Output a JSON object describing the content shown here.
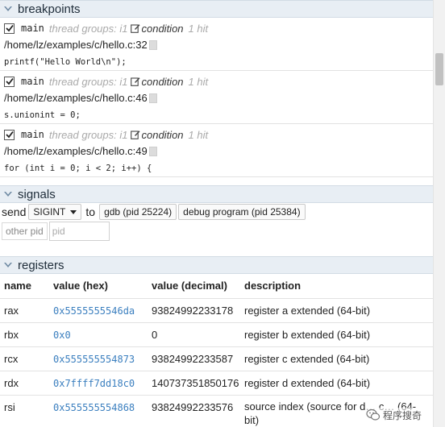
{
  "sections": {
    "breakpoints": "breakpoints",
    "signals": "signals",
    "registers": "registers"
  },
  "breakpoints": [
    {
      "checked": true,
      "function": "main",
      "thread_groups": "thread groups: i1",
      "condition": "condition",
      "hits": "1 hit",
      "location": "/home/lz/examples/c/hello.c:32",
      "code": "printf(\"Hello World\\n\");"
    },
    {
      "checked": true,
      "function": "main",
      "thread_groups": "thread groups: i1",
      "condition": "condition",
      "hits": "1 hit",
      "location": "/home/lz/examples/c/hello.c:46",
      "code": "s.unionint = 0;"
    },
    {
      "checked": true,
      "function": "main",
      "thread_groups": "thread groups: i1",
      "condition": "condition",
      "hits": "1 hit",
      "location": "/home/lz/examples/c/hello.c:49",
      "code": "for (int i = 0; i < 2; i++) {"
    }
  ],
  "signals": {
    "send_label": "send",
    "signal_selected": "SIGINT",
    "to_label": "to",
    "gdb_button": "gdb (pid 25224)",
    "program_button": "debug program (pid 25384)",
    "other_pid_button": "other pid",
    "pid_placeholder": "pid"
  },
  "registers": {
    "columns": [
      "name",
      "value (hex)",
      "value (decimal)",
      "description"
    ],
    "rows": [
      {
        "name": "rax",
        "hex": "0x5555555546da",
        "decimal": "93824992233178",
        "description": "register a extended (64-bit)"
      },
      {
        "name": "rbx",
        "hex": "0x0",
        "decimal": "0",
        "description": "register b extended (64-bit)"
      },
      {
        "name": "rcx",
        "hex": "0x555555554873",
        "decimal": "93824992233587",
        "description": "register c extended (64-bit)"
      },
      {
        "name": "rdx",
        "hex": "0x7ffff7dd18c0",
        "decimal": "140737351850176",
        "description": "register d extended (64-bit)"
      },
      {
        "name": "rsi",
        "hex": "0x555555554868",
        "decimal": "93824992233576",
        "description": "source index (source for d… c… (64-bit)"
      }
    ]
  },
  "watermark": "程序搜奇",
  "colors": {
    "header_bg": "#e8eef4",
    "hex_value": "#3b7fbf",
    "muted": "#aaaaaa"
  }
}
